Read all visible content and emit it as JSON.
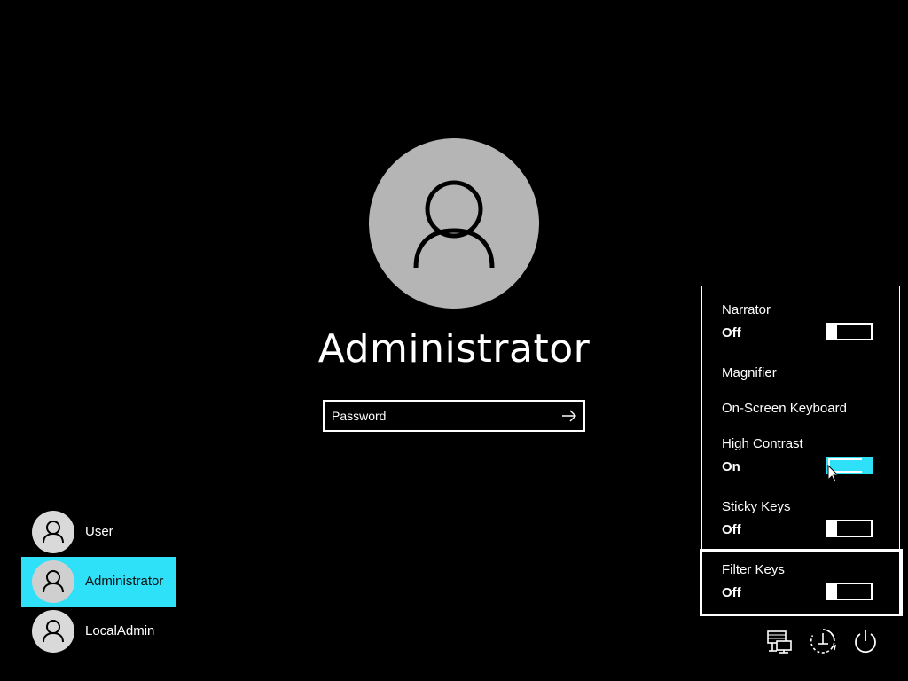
{
  "login": {
    "username": "Administrator",
    "password_placeholder": "Password"
  },
  "users": [
    {
      "name": "User",
      "selected": false
    },
    {
      "name": "Administrator",
      "selected": true
    },
    {
      "name": "LocalAdmin",
      "selected": false
    }
  ],
  "ease_of_access": {
    "narrator": {
      "label": "Narrator",
      "state": "Off"
    },
    "magnifier": {
      "label": "Magnifier"
    },
    "onscreen_keyboard": {
      "label": "On-Screen Keyboard"
    },
    "high_contrast": {
      "label": "High Contrast",
      "state": "On"
    },
    "sticky_keys": {
      "label": "Sticky Keys",
      "state": "Off"
    },
    "filter_keys": {
      "label": "Filter Keys",
      "state": "Off"
    }
  },
  "bottom_icons": [
    "network-icon",
    "ease-of-access-icon",
    "power-icon"
  ],
  "colors": {
    "accent": "#2ee0f8",
    "avatar": "#b5b5b5",
    "background": "#000000"
  }
}
